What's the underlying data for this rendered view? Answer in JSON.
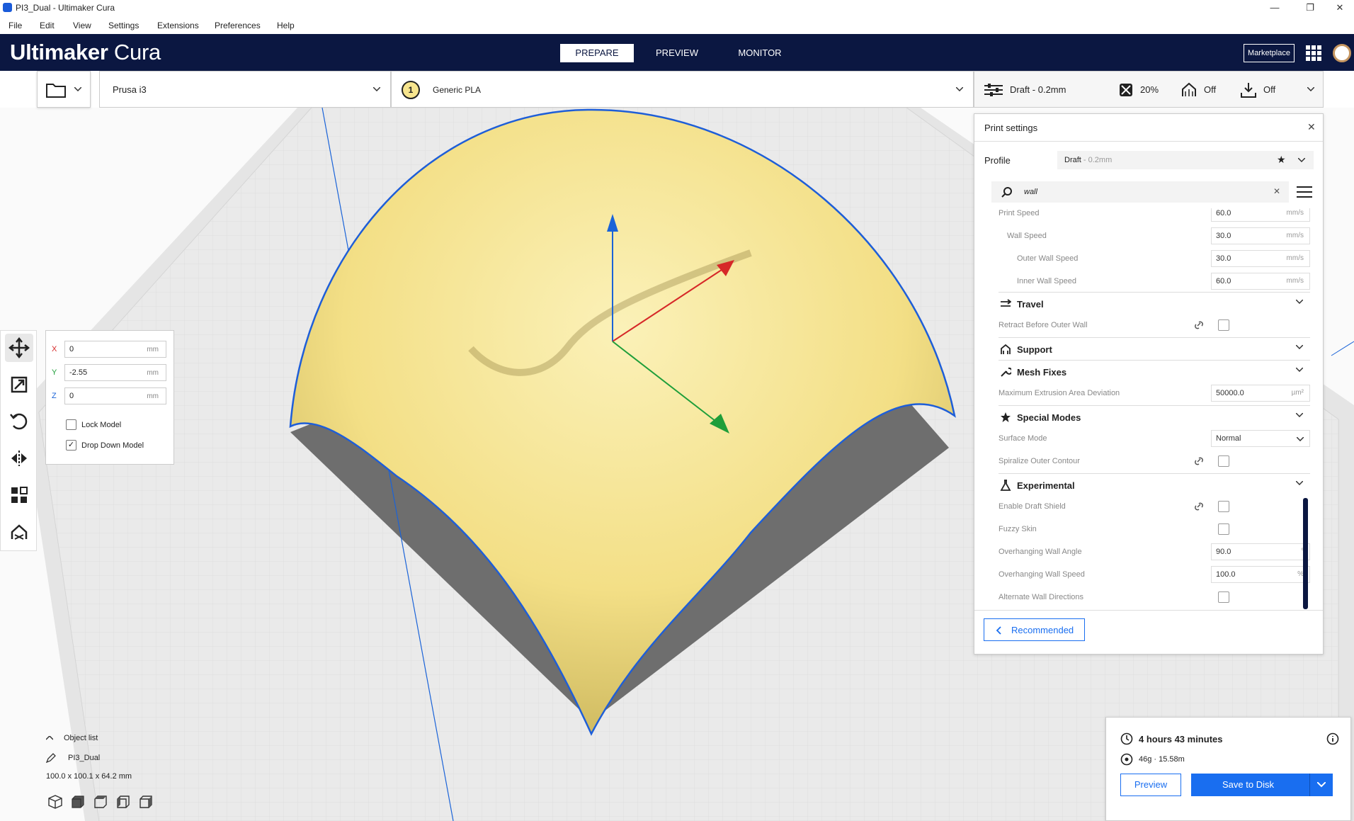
{
  "window": {
    "title": "PI3_Dual - Ultimaker Cura",
    "minimize_icon": "minimize-icon",
    "restore_icon": "restore-icon",
    "close_icon": "close-icon"
  },
  "menu": {
    "items": [
      "File",
      "Edit",
      "View",
      "Settings",
      "Extensions",
      "Preferences",
      "Help"
    ]
  },
  "header": {
    "logo_brand": "Ultimaker",
    "logo_product": "Cura",
    "stages": [
      "PREPARE",
      "PREVIEW",
      "MONITOR"
    ],
    "active_stage": "PREPARE",
    "marketplace_label": "Marketplace"
  },
  "toolbar": {
    "printer_name": "Prusa i3",
    "extruder_number": "1",
    "material": "Generic PLA",
    "profile": "Draft - 0.2mm",
    "infill": "20%",
    "support": "Off",
    "adhesion": "Off"
  },
  "move_panel": {
    "x_label": "X",
    "x_value": "0",
    "y_label": "Y",
    "y_value": "-2.55",
    "z_label": "Z",
    "z_value": "0",
    "unit": "mm",
    "lock_model_label": "Lock Model",
    "lock_model_checked": false,
    "drop_down_label": "Drop Down Model",
    "drop_down_checked": true
  },
  "print_settings": {
    "title": "Print settings",
    "profile_label": "Profile",
    "profile_name": "Draft",
    "profile_suffix": " - 0.2mm",
    "search_value": "wall",
    "rows_speed": [
      {
        "label": "Print Speed",
        "value": "60.0",
        "unit": "mm/s"
      },
      {
        "label": "Wall Speed",
        "value": "30.0",
        "unit": "mm/s"
      },
      {
        "label": "Outer Wall Speed",
        "value": "30.0",
        "unit": "mm/s"
      },
      {
        "label": "Inner Wall Speed",
        "value": "60.0",
        "unit": "mm/s"
      }
    ],
    "cat_travel": "Travel",
    "retract_before_outer_wall": "Retract Before Outer Wall",
    "cat_support": "Support",
    "cat_mesh_fixes": "Mesh Fixes",
    "max_extrusion_label": "Maximum Extrusion Area Deviation",
    "max_extrusion_value": "50000.0",
    "max_extrusion_unit": "µm²",
    "cat_special_modes": "Special Modes",
    "surface_mode_label": "Surface Mode",
    "surface_mode_value": "Normal",
    "spiralize_label": "Spiralize Outer Contour",
    "cat_experimental": "Experimental",
    "draft_shield_label": "Enable Draft Shield",
    "fuzzy_skin_label": "Fuzzy Skin",
    "overhang_angle_label": "Overhanging Wall Angle",
    "overhang_angle_value": "90.0",
    "overhang_angle_unit": "°",
    "overhang_speed_label": "Overhanging Wall Speed",
    "overhang_speed_value": "100.0",
    "overhang_speed_unit": "%",
    "alternate_wall_label": "Alternate Wall Directions",
    "recommended_label": "Recommended"
  },
  "object_list": {
    "label": "Object list",
    "object_name": "PI3_Dual",
    "dimensions": "100.0 x 100.1 x 64.2 mm"
  },
  "job": {
    "time": "4 hours 43 minutes",
    "material_usage": "46g · 15.58m",
    "preview_label": "Preview",
    "save_label": "Save to Disk"
  },
  "colors": {
    "header": "#0b1741",
    "accent": "#196ef0",
    "model": "#f7e58e"
  }
}
